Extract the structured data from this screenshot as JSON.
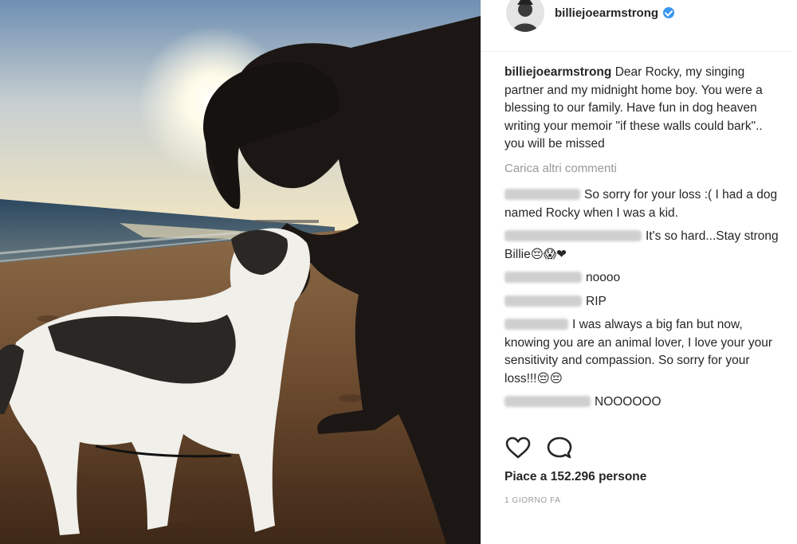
{
  "post": {
    "username": "billiejoearmstrong",
    "caption_user": "billiejoearmstrong",
    "caption_text": "Dear Rocky, my singing partner and my midnight home boy. You were a blessing to our family. Have fun in dog heaven writing your memoir \"if these walls could bark\".. you will be missed",
    "load_more": "Carica altri commenti",
    "likes": "Piace a 152.296 persone",
    "time": "1 GIORNO FA"
  },
  "comments": [
    {
      "text": "So sorry for your loss :( I had a dog named Rocky when I was a kid."
    },
    {
      "text": "It's so hard...Stay strong Billie😔😱❤"
    },
    {
      "text": "noooo"
    },
    {
      "text": "RIP"
    },
    {
      "text": "I was always a big fan but now, knowing you are an animal lover, I love your your sensitivity and compassion. So sorry for your loss!!!😔😔"
    },
    {
      "text": "NOOOOOO"
    }
  ],
  "icons": {
    "like": "heart-outline-icon",
    "comment": "speech-bubble-icon",
    "verified": "verified-badge-icon"
  },
  "colors": {
    "verified": "#3897f0",
    "muted": "#999999",
    "text": "#262626"
  }
}
